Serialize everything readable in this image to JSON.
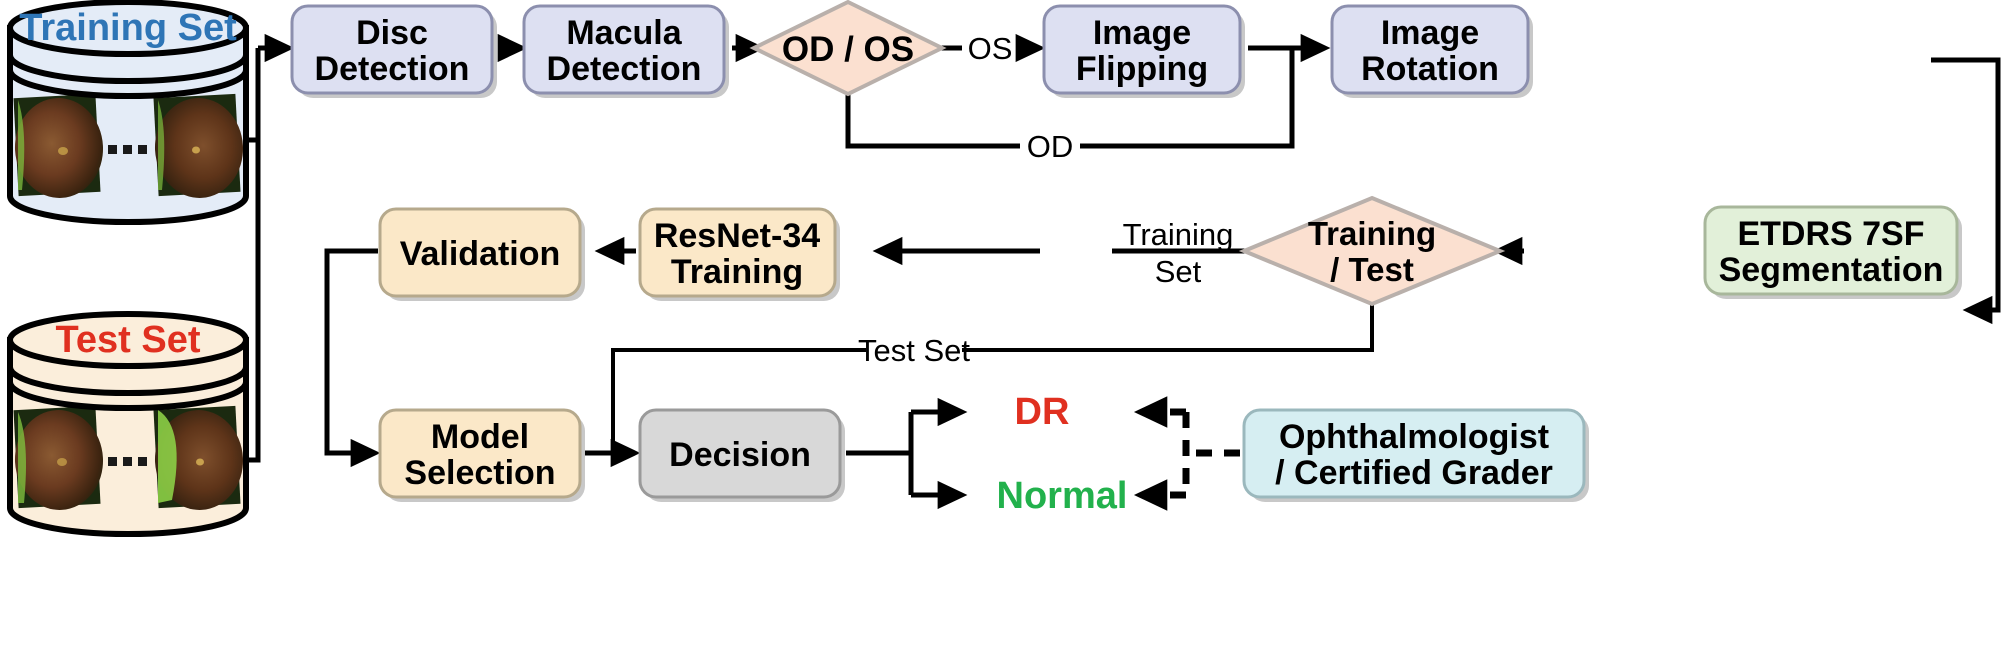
{
  "diagram": {
    "title": "Diabetic Retinopathy Deep Learning Pipeline Flowchart",
    "colors": {
      "process_blue_fill": "#dde0f2",
      "process_blue_stroke": "#8c8fae",
      "decision_peach_fill": "#fbe0d0",
      "decision_peach_stroke": "#b9b0ab",
      "stage_cream_fill": "#fbe8c8",
      "stage_cream_stroke": "#b6a98c",
      "segment_green_fill": "#e2f0d9",
      "segment_green_stroke": "#a8b79b",
      "decision_gray_fill": "#d8d8d8",
      "decision_gray_stroke": "#9a9a9a",
      "grader_cyan_fill": "#d6eef2",
      "grader_cyan_stroke": "#9bb8bd",
      "training_db_fill": "#e4ecf7",
      "training_db_title": "#2e75b6",
      "test_db_fill": "#fbeedb",
      "test_db_title": "#e03020",
      "dr_label": "#e03020",
      "normal_label": "#22b14c",
      "line": "#000000"
    },
    "databases": [
      {
        "id": "training-set-db",
        "label": "Training Set",
        "thumbs": 2,
        "ellipsis": "..."
      },
      {
        "id": "test-set-db",
        "label": "Test Set",
        "thumbs": 2,
        "ellipsis": "..."
      }
    ],
    "nodes": [
      {
        "id": "disc-detection",
        "label_lines": [
          "Disc",
          "Detection"
        ],
        "shape": "rounded-rect",
        "kind": "process"
      },
      {
        "id": "macula-detection",
        "label_lines": [
          "Macula",
          "Detection"
        ],
        "shape": "rounded-rect",
        "kind": "process"
      },
      {
        "id": "od-os-decision",
        "label_lines": [
          "OD / OS"
        ],
        "shape": "diamond",
        "kind": "decision"
      },
      {
        "id": "image-flipping",
        "label_lines": [
          "Image",
          "Flipping"
        ],
        "shape": "rounded-rect",
        "kind": "process"
      },
      {
        "id": "image-rotation",
        "label_lines": [
          "Image",
          "Rotation"
        ],
        "shape": "rounded-rect",
        "kind": "process"
      },
      {
        "id": "etdrs-7sf-segmentation",
        "label_lines": [
          "ETDRS 7SF",
          "Segmentation"
        ],
        "shape": "rounded-rect",
        "kind": "segment"
      },
      {
        "id": "training-test-decision",
        "label_lines": [
          "Training",
          "/ Test"
        ],
        "shape": "diamond",
        "kind": "decision"
      },
      {
        "id": "resnet-34-training",
        "label_lines": [
          "ResNet-34",
          "Training"
        ],
        "shape": "rounded-rect",
        "kind": "stage"
      },
      {
        "id": "validation",
        "label_lines": [
          "Validation"
        ],
        "shape": "rounded-rect",
        "kind": "stage"
      },
      {
        "id": "model-selection",
        "label_lines": [
          "Model",
          "Selection"
        ],
        "shape": "rounded-rect",
        "kind": "stage"
      },
      {
        "id": "decision",
        "label_lines": [
          "Decision"
        ],
        "shape": "rounded-rect",
        "kind": "gray"
      },
      {
        "id": "ophthalmologist-grader",
        "label_lines": [
          "Ophthalmologist",
          "/ Certified Grader"
        ],
        "shape": "rounded-rect",
        "kind": "grader"
      }
    ],
    "edge_labels": {
      "os": "OS",
      "od": "OD",
      "training_set_line1": "Training",
      "training_set_line2": "Set",
      "test_set": "Test Set"
    },
    "outcomes": [
      {
        "id": "outcome-dr",
        "label": "DR",
        "color": "#e03020"
      },
      {
        "id": "outcome-normal",
        "label": "Normal",
        "color": "#22b14c"
      }
    ],
    "text": {
      "disc_l1": "Disc",
      "disc_l2": "Detection",
      "macula_l1": "Macula",
      "macula_l2": "Detection",
      "odos": "OD / OS",
      "flip_l1": "Image",
      "flip_l2": "Flipping",
      "rot_l1": "Image",
      "rot_l2": "Rotation",
      "etdrs_l1": "ETDRS 7SF",
      "etdrs_l2": "Segmentation",
      "tt_l1": "Training",
      "tt_l2": "/ Test",
      "resnet_l1": "ResNet-34",
      "resnet_l2": "Training",
      "validation": "Validation",
      "model_l1": "Model",
      "model_l2": "Selection",
      "decision": "Decision",
      "grader_l1": "Ophthalmologist",
      "grader_l2": "/ Certified Grader",
      "training_db": "Training Set",
      "test_db": "Test Set",
      "ellipsis_top": "...",
      "ellipsis_bottom": "..."
    }
  }
}
